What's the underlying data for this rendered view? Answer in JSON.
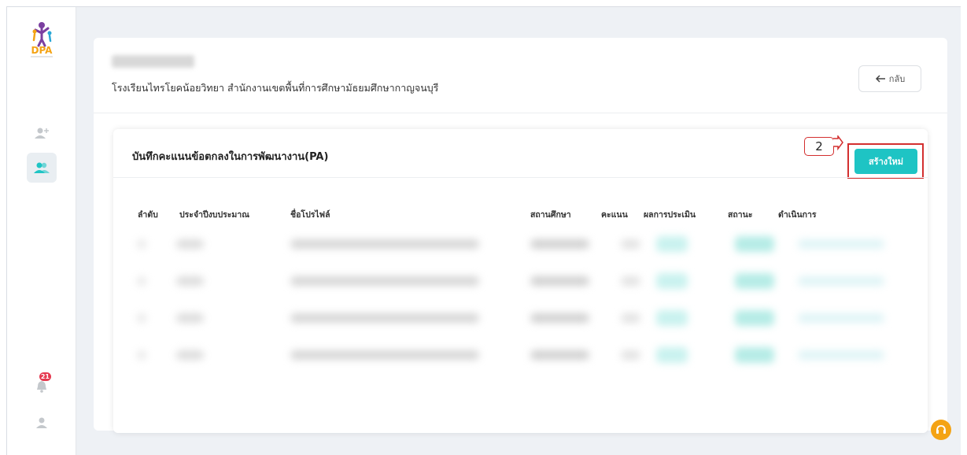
{
  "header": {
    "school_name": "โรงเรียนไทรโยคน้อยวิทยา สำนักงานเขตพื้นที่การศึกษามัธยมศึกษากาญจนบุรี",
    "back_label": "กลับ"
  },
  "section": {
    "title": "บันทึกคะแนนข้อตกลงในการพัฒนางาน(PA)",
    "create_label": "สร้างใหม่",
    "step_number": "2"
  },
  "table": {
    "columns": [
      "ลำดับ",
      "ประจำปีงบประมาณ",
      "ชื่อโปรไฟล์",
      "สถานศึกษา",
      "คะแนน",
      "ผลการประเมิน",
      "สถานะ",
      "ดำเนินการ"
    ]
  },
  "sidebar": {
    "notification_count": "21"
  },
  "colors": {
    "accent": "#1ec4c4",
    "highlight": "#d32f2f",
    "help": "#f4a314"
  }
}
